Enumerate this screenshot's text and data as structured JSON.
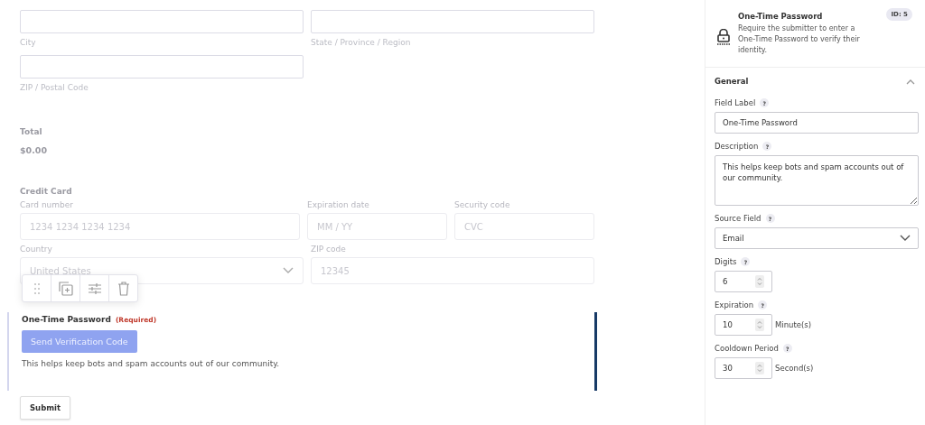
{
  "address_fields": [
    {
      "label": "City"
    },
    {
      "label": "State / Province / Region"
    },
    {
      "label": "ZIP / Postal Code"
    }
  ],
  "total": {
    "label": "Total",
    "value": "$0.00"
  },
  "credit_card": {
    "title": "Credit Card",
    "rows": [
      [
        {
          "kind": "input",
          "label": "Card number",
          "placeholder": "1234 1234 1234 1234"
        },
        {
          "kind": "input",
          "label": "Expiration date",
          "placeholder": "MM / YY"
        },
        {
          "kind": "input",
          "label": "Security code",
          "placeholder": "CVC"
        }
      ],
      [
        {
          "kind": "select",
          "label": "Country",
          "value": "United States"
        },
        {
          "kind": "input",
          "label": "ZIP code",
          "placeholder": "12345"
        }
      ]
    ]
  },
  "otp_field": {
    "label": "One-Time Password",
    "required": "(Required)",
    "button": "Send Verification Code",
    "description": "This helps keep bots and spam accounts out of our community.",
    "selected": true
  },
  "submit": "Submit",
  "panel": {
    "title": "One-Time Password",
    "description": "Require the submitter to enter a One-Time Password to verify their identity.",
    "id_badge": "ID: 5",
    "section": {
      "title": "General",
      "expanded": true
    },
    "settings": [
      {
        "kind": "text",
        "label": "Field Label",
        "help": "?",
        "value": "One-Time Password"
      },
      {
        "kind": "textarea",
        "label": "Description",
        "help": "?",
        "value": "This helps keep bots and spam accounts out of our community."
      },
      {
        "kind": "select",
        "label": "Source Field",
        "help": "?",
        "value": "Email"
      },
      {
        "kind": "number",
        "label": "Digits",
        "help": "?",
        "value": "6"
      },
      {
        "kind": "number",
        "label": "Expiration",
        "help": "?",
        "value": "10",
        "unit": "Minute(s)"
      },
      {
        "kind": "number",
        "label": "Cooldown Period",
        "help": "?",
        "value": "30",
        "unit": "Second(s)"
      }
    ]
  }
}
